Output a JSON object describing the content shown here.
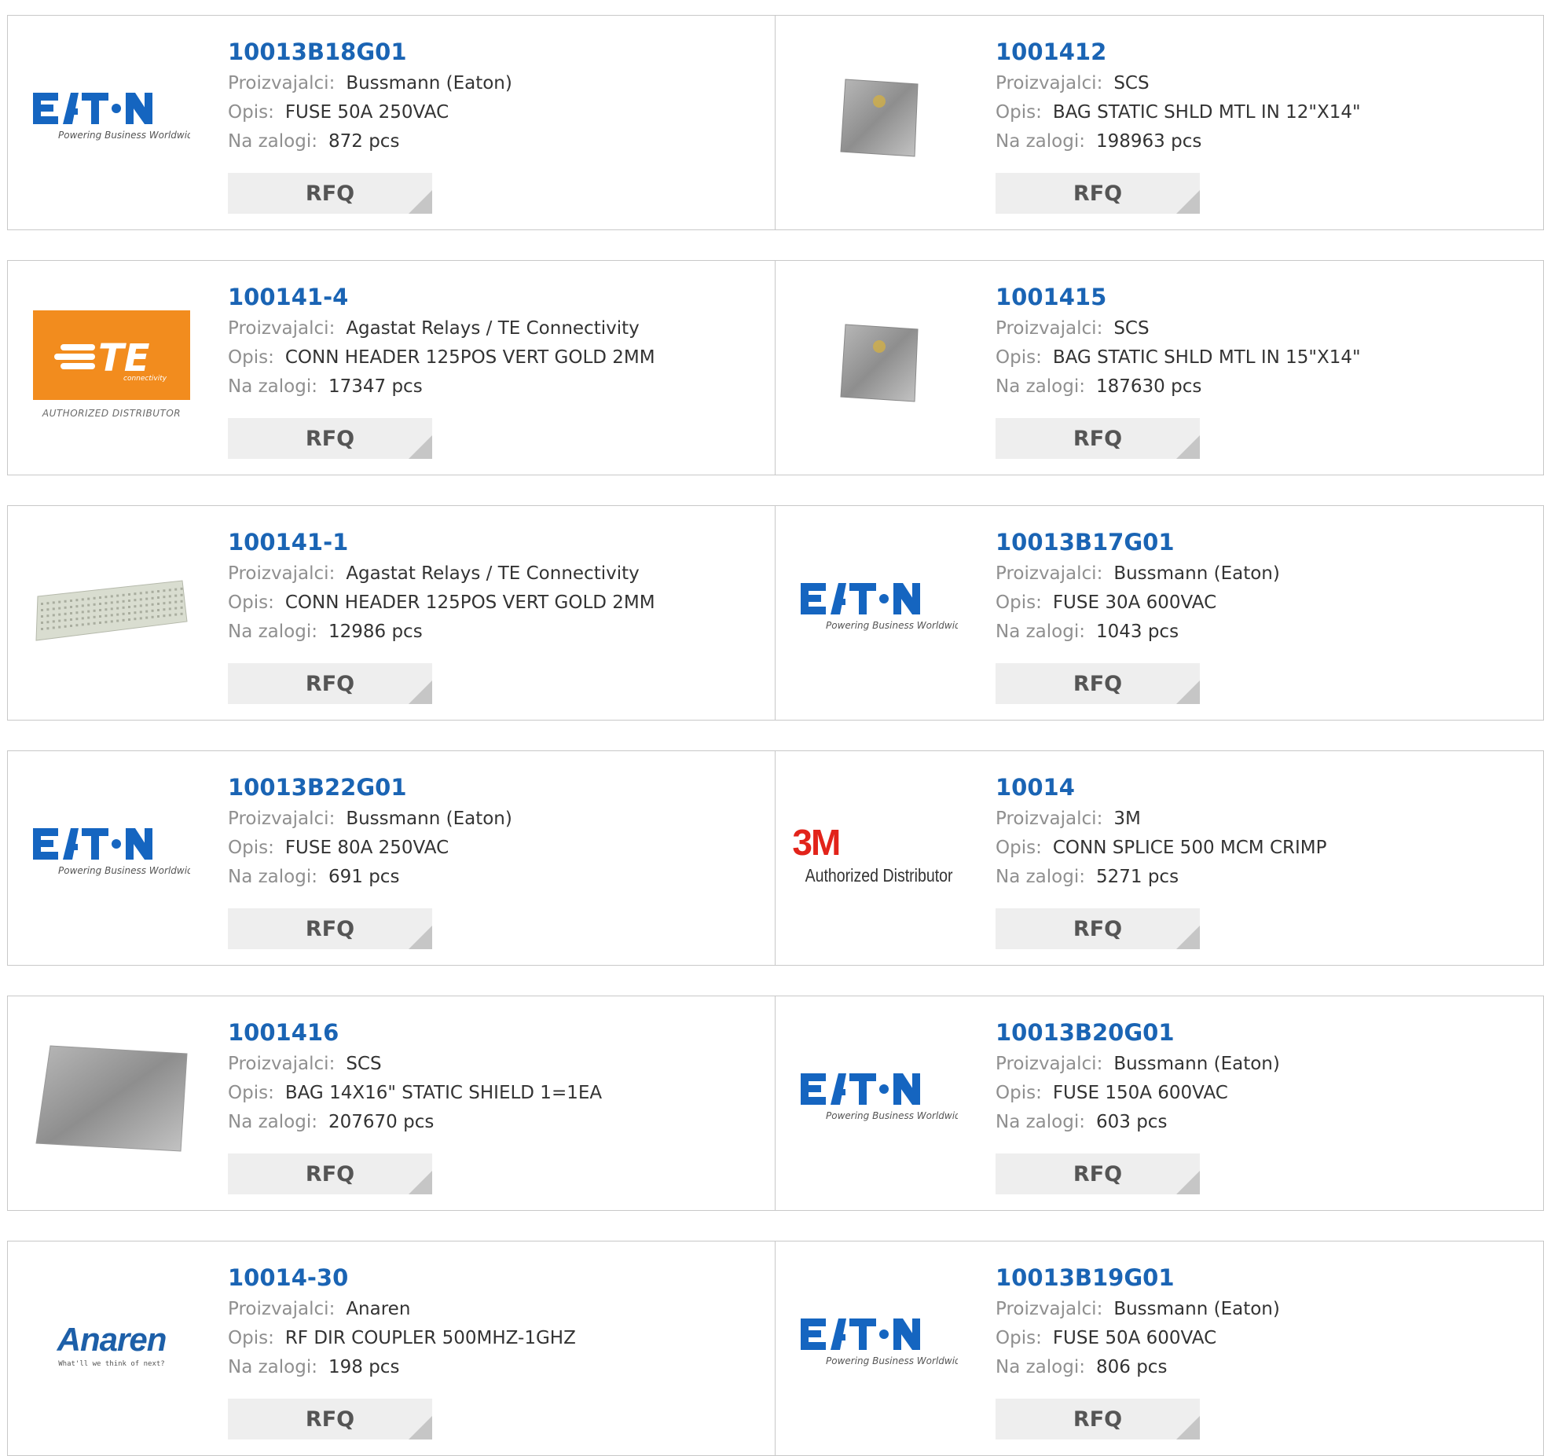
{
  "labels": {
    "manufacturer": "Proizvajalci:",
    "description": "Opis:",
    "stock": "Na zalogi:",
    "rfq": "RFQ"
  },
  "products": [
    {
      "part": "10013B18G01",
      "manufacturer": "Bussmann (Eaton)",
      "description": "FUSE 50A 250VAC",
      "stock": "872 pcs",
      "logo": "eaton",
      "logo_text": "Powering Business Worldwide"
    },
    {
      "part": "1001412",
      "manufacturer": "SCS",
      "description": "BAG STATIC SHLD MTL IN 12\"X14\"",
      "stock": "198963 pcs",
      "logo": "static-bag-small"
    },
    {
      "part": "100141-4",
      "manufacturer": "Agastat Relays / TE Connectivity",
      "description": "CONN HEADER 125POS VERT GOLD 2MM",
      "stock": "17347 pcs",
      "logo": "te",
      "logo_text": "AUTHORIZED DISTRIBUTOR"
    },
    {
      "part": "1001415",
      "manufacturer": "SCS",
      "description": "BAG STATIC SHLD MTL IN 15\"X14\"",
      "stock": "187630 pcs",
      "logo": "static-bag-small"
    },
    {
      "part": "100141-1",
      "manufacturer": "Agastat Relays / TE Connectivity",
      "description": "CONN HEADER 125POS VERT GOLD 2MM",
      "stock": "12986 pcs",
      "logo": "connector-header"
    },
    {
      "part": "10013B17G01",
      "manufacturer": "Bussmann (Eaton)",
      "description": "FUSE 30A 600VAC",
      "stock": "1043 pcs",
      "logo": "eaton",
      "logo_text": "Powering Business Worldwide"
    },
    {
      "part": "10013B22G01",
      "manufacturer": "Bussmann (Eaton)",
      "description": "FUSE 80A 250VAC",
      "stock": "691 pcs",
      "logo": "eaton",
      "logo_text": "Powering Business Worldwide"
    },
    {
      "part": "10014",
      "manufacturer": "3M",
      "description": "CONN SPLICE 500 MCM CRIMP",
      "stock": "5271 pcs",
      "logo": "3m",
      "logo_text": "Authorized Distributor"
    },
    {
      "part": "1001416",
      "manufacturer": "SCS",
      "description": "BAG 14X16\" STATIC SHIELD 1=1EA",
      "stock": "207670 pcs",
      "logo": "static-bag-large"
    },
    {
      "part": "10013B20G01",
      "manufacturer": "Bussmann (Eaton)",
      "description": "FUSE 150A 600VAC",
      "stock": "603 pcs",
      "logo": "eaton",
      "logo_text": "Powering Business Worldwide"
    },
    {
      "part": "10014-30",
      "manufacturer": "Anaren",
      "description": "RF DIR COUPLER 500MHZ-1GHZ",
      "stock": "198 pcs",
      "logo": "anaren",
      "logo_text": "What'll we think of next?"
    },
    {
      "part": "10013B19G01",
      "manufacturer": "Bussmann (Eaton)",
      "description": "FUSE 50A 600VAC",
      "stock": "806 pcs",
      "logo": "eaton",
      "logo_text": "Powering Business Worldwide"
    }
  ],
  "colors": {
    "part_link": "#1a64b4",
    "label": "#8f8f8f",
    "value": "#333333",
    "rfq_bg": "#eeeeee",
    "border": "#c8c8c8",
    "eaton_blue": "#1565c0",
    "te_orange": "#f28c1e",
    "mmm_red": "#e2231a",
    "anaren_blue": "#1d5fa8"
  }
}
